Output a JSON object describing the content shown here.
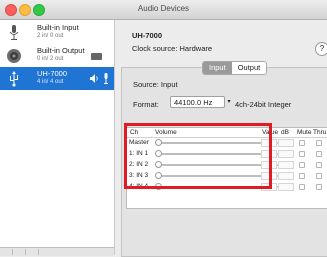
{
  "window": {
    "title": "Audio Devices"
  },
  "sidebar": {
    "devices": [
      {
        "name": "Built-in Input",
        "sub": "2 in/ 0 out"
      },
      {
        "name": "Built-in Output",
        "sub": "0 in/ 2 out"
      },
      {
        "name": "UH-7000",
        "sub": "4 in/ 4 out"
      }
    ]
  },
  "main": {
    "device_title": "UH-7000",
    "clock_source": "Clock source: Hardware",
    "help": "?",
    "tabs": [
      "Input",
      "Output"
    ],
    "source": "Source: Input",
    "format_label": "Format:",
    "format_value": "44100.0 Hz",
    "format_desc": "4ch-24bit Integer",
    "table": {
      "headers": {
        "ch": "Ch",
        "volume": "Volume",
        "value": "Value",
        "db": "dB",
        "mute": "Mute",
        "thru": "Thru"
      },
      "rows": [
        {
          "ch": "Master"
        },
        {
          "ch": "1: IN 1"
        },
        {
          "ch": "2: IN 2"
        },
        {
          "ch": "3: IN 3"
        },
        {
          "ch": "4: IN 4"
        }
      ]
    }
  }
}
